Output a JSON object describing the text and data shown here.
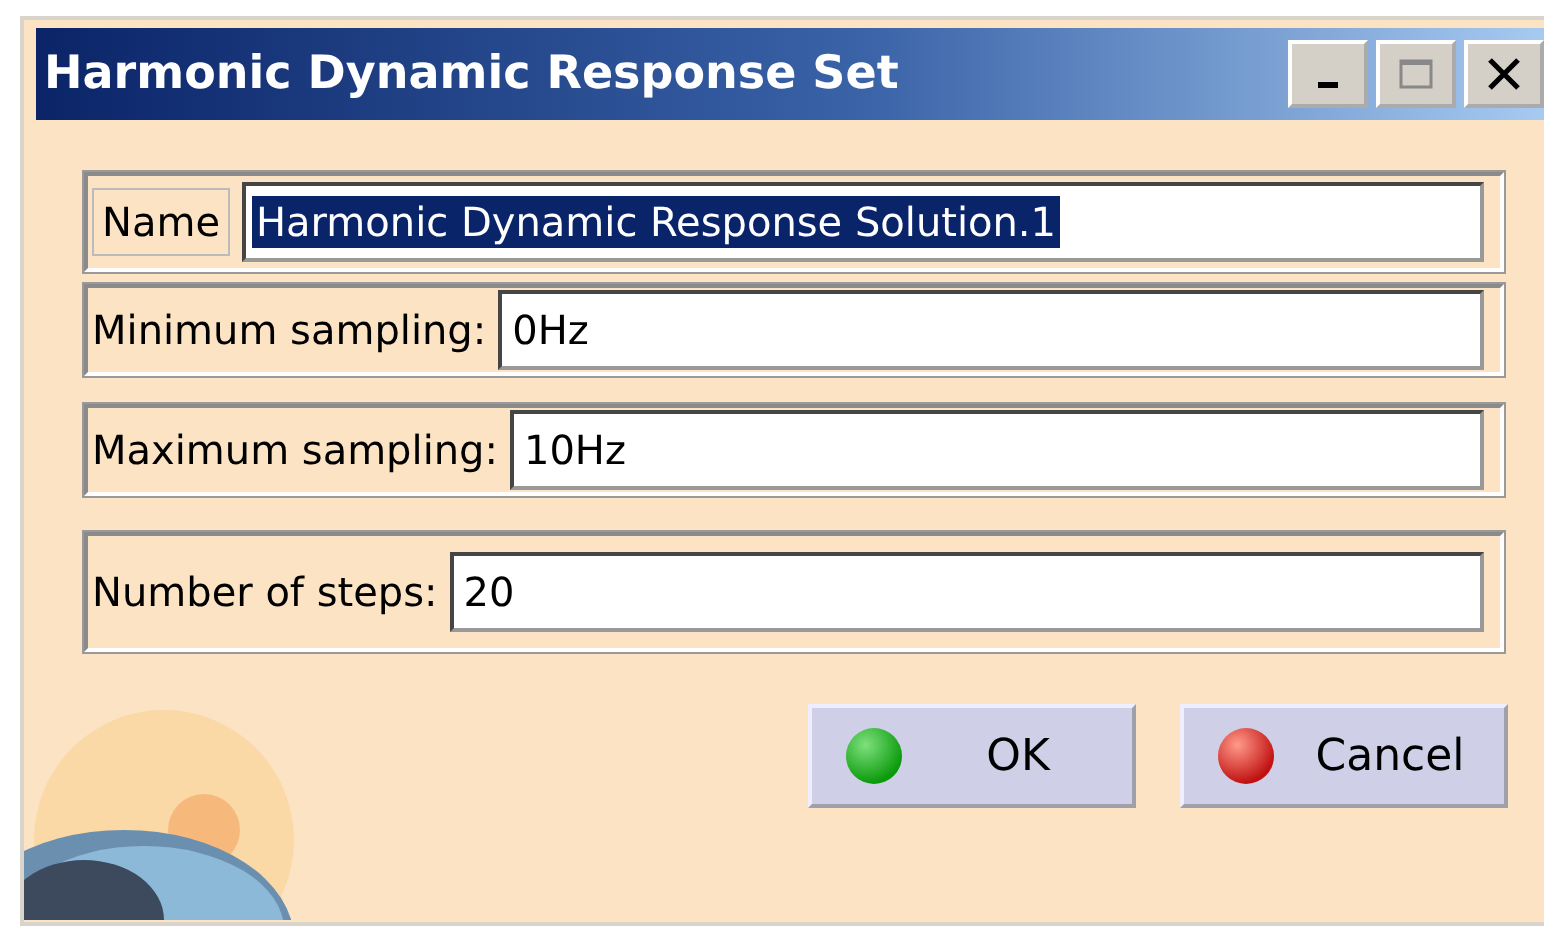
{
  "window": {
    "title": "Harmonic Dynamic Response Set",
    "controls": [
      {
        "kind": "minimize"
      },
      {
        "kind": "maximize"
      },
      {
        "kind": "close"
      }
    ]
  },
  "fields": [
    {
      "label": "Name",
      "value": "Harmonic Dynamic Response Solution.1",
      "selected": true,
      "kind": "tab"
    },
    {
      "label": "Minimum sampling:",
      "value": "0Hz",
      "selected": false,
      "kind": "plain"
    },
    {
      "label": "Maximum sampling:",
      "value": "10Hz",
      "selected": false,
      "kind": "plain"
    },
    {
      "label": "Number of steps:",
      "value": "20",
      "selected": false,
      "kind": "plain"
    }
  ],
  "buttons": [
    {
      "label": "OK",
      "kind": "ok"
    },
    {
      "label": "Cancel",
      "kind": "cancel"
    }
  ]
}
